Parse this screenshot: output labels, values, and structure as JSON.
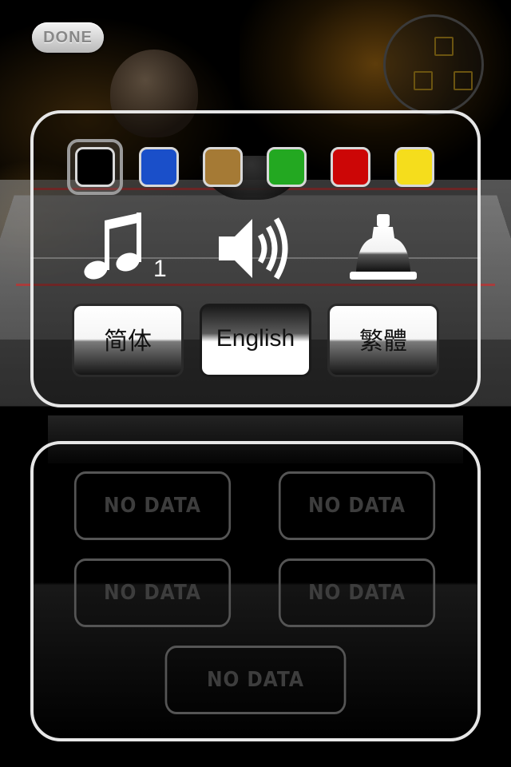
{
  "header": {
    "done_label": "DONE",
    "corner_icon": "camera-view-toggle-icon"
  },
  "colors": {
    "title": "piece-color-selector",
    "swatches": [
      {
        "name": "black-swatch",
        "hex": "#000000",
        "selected": true
      },
      {
        "name": "blue-swatch",
        "hex": "#1a4fc9",
        "selected": false
      },
      {
        "name": "brown-swatch",
        "hex": "#a57a35",
        "selected": false
      },
      {
        "name": "green-swatch",
        "hex": "#23a821",
        "selected": false
      },
      {
        "name": "red-swatch",
        "hex": "#cc0606",
        "selected": false
      },
      {
        "name": "yellow-swatch",
        "hex": "#f5dd1c",
        "selected": false
      }
    ]
  },
  "sound": {
    "music_icon": "music-notes-icon",
    "music_track": "1",
    "speaker_icon": "speaker-volume-icon",
    "bell_icon": "bell-icon"
  },
  "languages": [
    {
      "label": "简体",
      "active": false
    },
    {
      "label": "English",
      "active": true
    },
    {
      "label": "繁體",
      "active": false
    }
  ],
  "save_slots": [
    {
      "label": "NO DATA"
    },
    {
      "label": "NO DATA"
    },
    {
      "label": "NO DATA"
    },
    {
      "label": "NO DATA"
    },
    {
      "label": "NO DATA"
    }
  ]
}
